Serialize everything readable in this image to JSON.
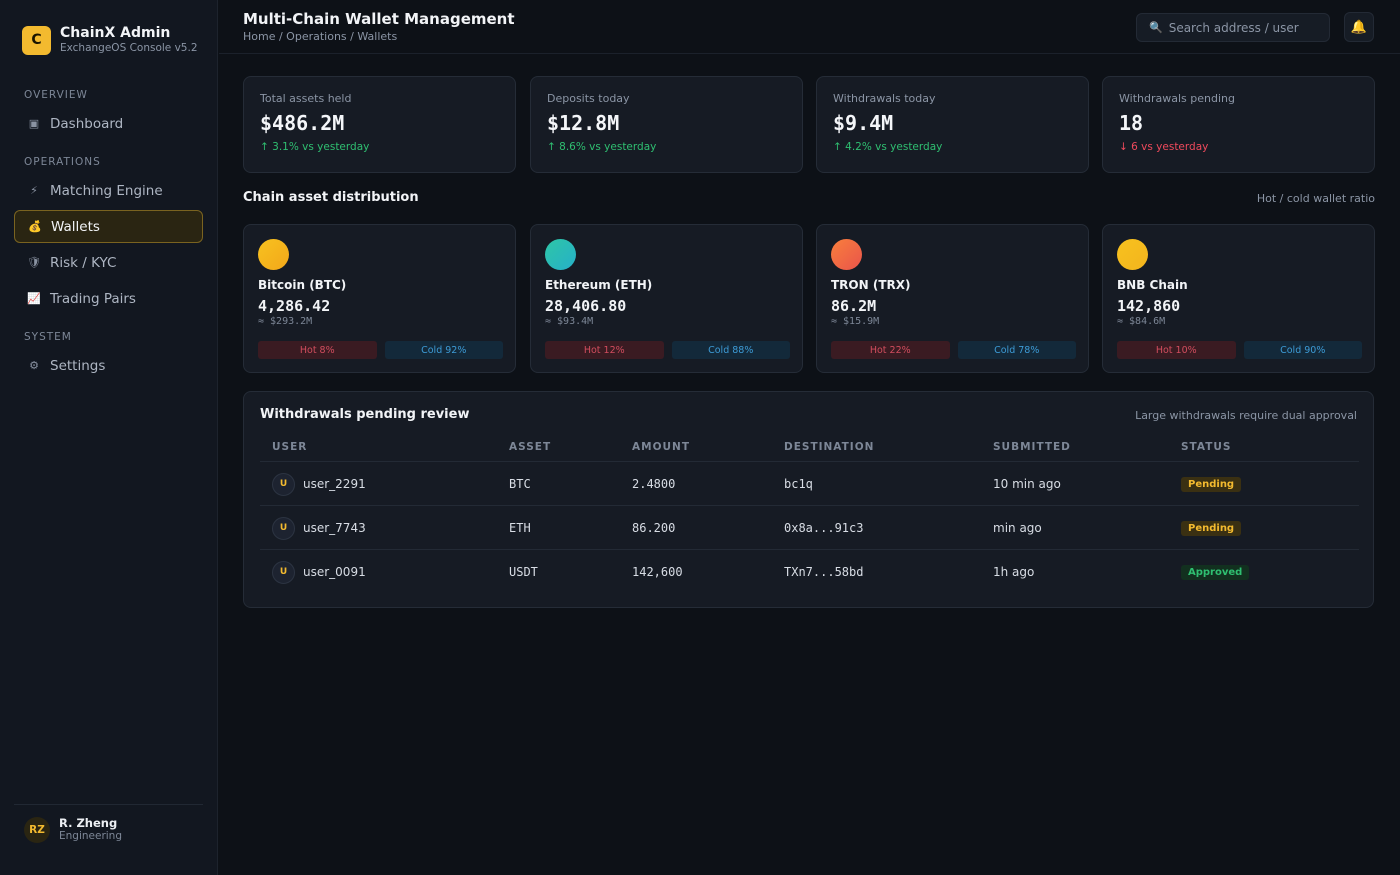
{
  "app": {
    "logo_letter": "C",
    "name": "ChainX Admin",
    "subtitle": "ExchangeOS Console v5.2"
  },
  "sidebar": {
    "sections": [
      {
        "title": "OVERVIEW"
      },
      {
        "title": "OPERATIONS"
      },
      {
        "title": "SYSTEM"
      }
    ],
    "items": [
      {
        "label": "Dashboard",
        "icon": "dashboard-icon",
        "glyph": "▣"
      },
      {
        "label": "Matching Engine",
        "icon": "lightning-icon",
        "glyph": "⚡"
      },
      {
        "label": "Wallets",
        "icon": "money-bag-icon",
        "glyph": "💰",
        "active": true
      },
      {
        "label": "Risk / KYC",
        "icon": "shield-icon",
        "glyph": "🛡"
      },
      {
        "label": "Trading Pairs",
        "icon": "chart-icon",
        "glyph": "📈"
      },
      {
        "label": "Settings",
        "icon": "gear-icon",
        "glyph": "⚙"
      }
    ],
    "user": {
      "initials": "RZ",
      "name": "R. Zheng",
      "role": "Engineering"
    }
  },
  "header": {
    "title": "Multi-Chain Wallet Management",
    "breadcrumb": "Home / Operations / Wallets",
    "search_placeholder": "Search address / user"
  },
  "stats": [
    {
      "label": "Total assets held",
      "value": "$486.2M",
      "delta": "↑ 3.1% vs yesterday",
      "trend": "up"
    },
    {
      "label": "Deposits today",
      "value": "$12.8M",
      "delta": "↑ 8.6% vs yesterday",
      "trend": "up"
    },
    {
      "label": "Withdrawals today",
      "value": "$9.4M",
      "delta": "↑ 4.2% vs yesterday",
      "trend": "up"
    },
    {
      "label": "Withdrawals pending",
      "value": "18",
      "delta": "↓ 6 vs yesterday",
      "trend": "down"
    }
  ],
  "distribution": {
    "title": "Chain asset distribution",
    "note": "Hot / cold wallet ratio",
    "chains": [
      {
        "name": "Bitcoin (BTC)",
        "amount": "4,286.42",
        "usd": "≈ $293.2M",
        "hot": "Hot 8%",
        "cold": "Cold 92%",
        "color_a": "#f7c21f",
        "color_b": "#f3a71a"
      },
      {
        "name": "Ethereum (ETH)",
        "amount": "28,406.80",
        "usd": "≈ $93.4M",
        "hot": "Hot 12%",
        "cold": "Cold 88%",
        "color_a": "#2ec6a6",
        "color_b": "#26b0c9"
      },
      {
        "name": "TRON (TRX)",
        "amount": "86.2M",
        "usd": "≈ $15.9M",
        "hot": "Hot 22%",
        "cold": "Cold 78%",
        "color_a": "#f97f3c",
        "color_b": "#e9544b"
      },
      {
        "name": "BNB Chain",
        "amount": "142,860",
        "usd": "≈ $84.6M",
        "hot": "Hot 10%",
        "cold": "Cold 90%",
        "color_a": "#f7c21f",
        "color_b": "#f3b41d"
      }
    ]
  },
  "withdrawals": {
    "title": "Withdrawals pending review",
    "note": "Large withdrawals require dual approval",
    "columns": [
      "USER",
      "ASSET",
      "AMOUNT",
      "DESTINATION",
      "SUBMITTED",
      "STATUS"
    ],
    "rows": [
      {
        "initial": "U",
        "user": "user_2291",
        "asset": "BTC",
        "amount": "2.4800",
        "destination": "bc1q",
        "submitted": "10 min ago",
        "status": "Pending"
      },
      {
        "initial": "U",
        "user": "user_7743",
        "asset": "ETH",
        "amount": "86.200",
        "destination": "0x8a...91c3",
        "submitted": "min ago",
        "status": "Pending"
      },
      {
        "initial": "U",
        "user": "user_0091",
        "asset": "USDT",
        "amount": "142,600",
        "destination": "TXn7...58bd",
        "submitted": "1h ago",
        "status": "Approved"
      }
    ]
  },
  "colors": {
    "accent": "#f3ba2f",
    "up": "#2fbf71",
    "down": "#ef4a5c",
    "background": "#0d1117"
  }
}
